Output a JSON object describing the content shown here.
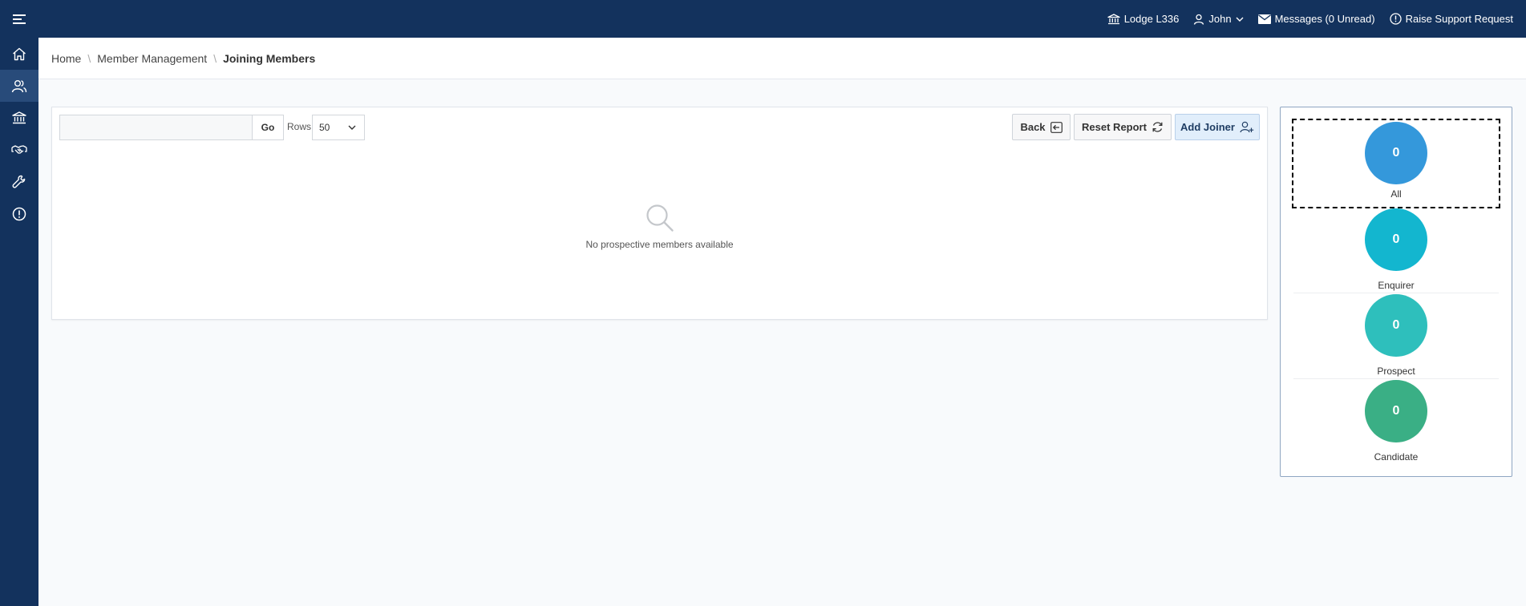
{
  "header": {
    "lodge": "Lodge L336",
    "user": "John",
    "messages": "Messages (0 Unread)",
    "support": "Raise Support Request"
  },
  "sidebar": {
    "items": [
      {
        "icon": "home-icon"
      },
      {
        "icon": "users-icon",
        "active": true
      },
      {
        "icon": "bank-icon"
      },
      {
        "icon": "handshake-icon"
      },
      {
        "icon": "wrench-icon"
      },
      {
        "icon": "alert-icon"
      }
    ]
  },
  "breadcrumb": {
    "home": "Home",
    "member_management": "Member Management",
    "current": "Joining Members"
  },
  "toolbar": {
    "search_value": "",
    "go_label": "Go",
    "rows_label": "Rows",
    "rows_value": "50",
    "back_label": "Back",
    "reset_label": "Reset Report",
    "add_label": "Add Joiner"
  },
  "report": {
    "empty_message": "No prospective members available"
  },
  "badges": [
    {
      "count": "0",
      "label": "All",
      "color": "#3498db",
      "selected": true
    },
    {
      "count": "0",
      "label": "Enquirer",
      "color": "#13b6cf"
    },
    {
      "count": "0",
      "label": "Prospect",
      "color": "#2ebfbc"
    },
    {
      "count": "0",
      "label": "Candidate",
      "color": "#3aaf85"
    }
  ],
  "colors": {
    "header_bg": "#13325d",
    "sidebar_active": "#284b7a"
  }
}
